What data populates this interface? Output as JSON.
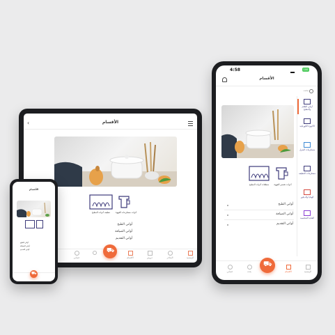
{
  "tablet": {
    "title": "الأقسام",
    "categories": [
      "أواني الطبخ",
      "أواني الضيافة",
      "أواني التقديم"
    ],
    "products": [
      {
        "label": "تنظيف أدوات المطبخ"
      },
      {
        "label": "أدوات مستلزمات القهوة"
      }
    ],
    "tabs": [
      "الرئيسية",
      "المتاجر",
      "عروض",
      "الأقسام",
      "",
      "حسابي"
    ]
  },
  "phone_small": {
    "title": "الأقسام",
    "categories": [
      "أواني الطبخ",
      "أواني الضيافة",
      "أواني التقديم"
    ]
  },
  "phone_large": {
    "time": "4:58",
    "battery": "100",
    "title": "الأقسام",
    "search_placeholder": "بحث",
    "sidebar": [
      "أواني الطعم والمطبخ",
      "الأجهزة الكهربائية",
      "مستلزمات المنزل",
      "مستلزمات التنظيف",
      "الهدايا والديكور",
      "العناية الشخصية"
    ],
    "products": [
      {
        "label": "أدوات تحضير القهوة"
      },
      {
        "label": "منظفات أدوات المطبخ"
      }
    ],
    "categories": [
      "أواني الطبخ",
      "أواني الضيافة",
      "أواني التقديم"
    ],
    "tabs": [
      "الرئيسية",
      "الأقسام",
      "",
      "بحث",
      "حسابي"
    ]
  },
  "colors": {
    "accent": "#ef6a3a",
    "text": "#333333",
    "bg": "#ebebec"
  }
}
